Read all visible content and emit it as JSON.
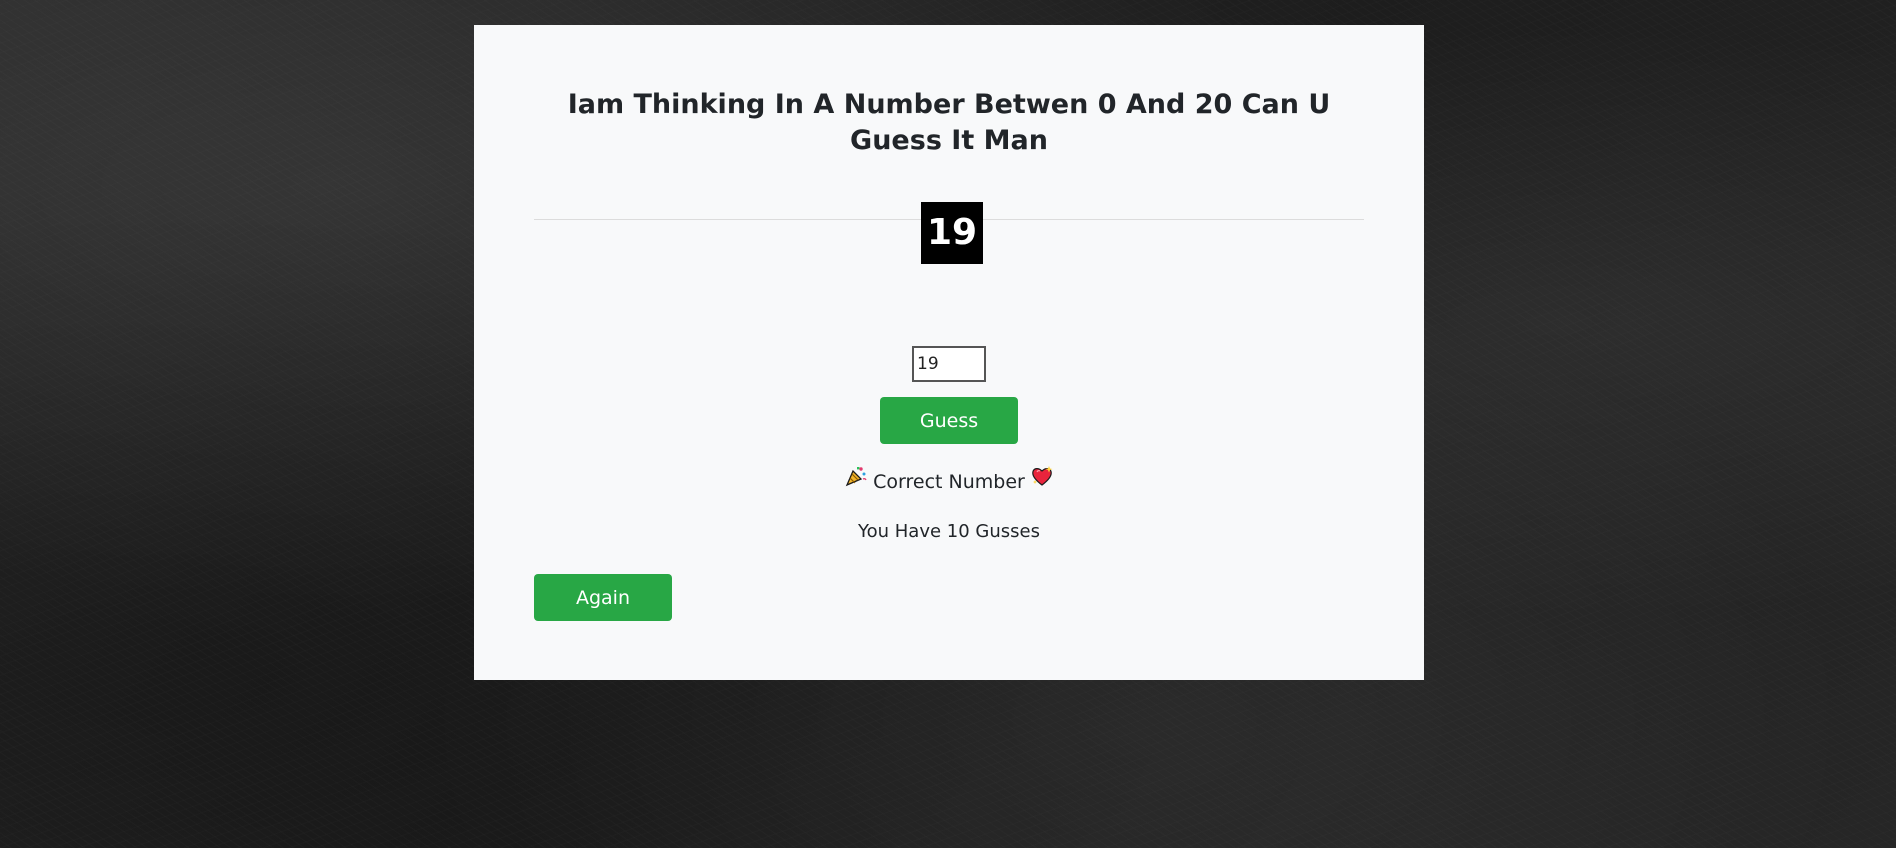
{
  "game": {
    "title": "Iam Thinking In A Number Betwen 0 And 20 Can U Guess It Man",
    "secret_number": "19",
    "guess_input_value": "19",
    "guess_button_label": "Guess",
    "message_text": "Correct Number",
    "message_icons": [
      "party-popper-icon",
      "sparkling-heart-icon"
    ],
    "guesses_text": "You Have 10 Gusses",
    "again_button_label": "Again"
  },
  "colors": {
    "card_background": "#f8f9fa",
    "button_green": "#28a745",
    "number_box": "#000000",
    "text": "#212529"
  }
}
